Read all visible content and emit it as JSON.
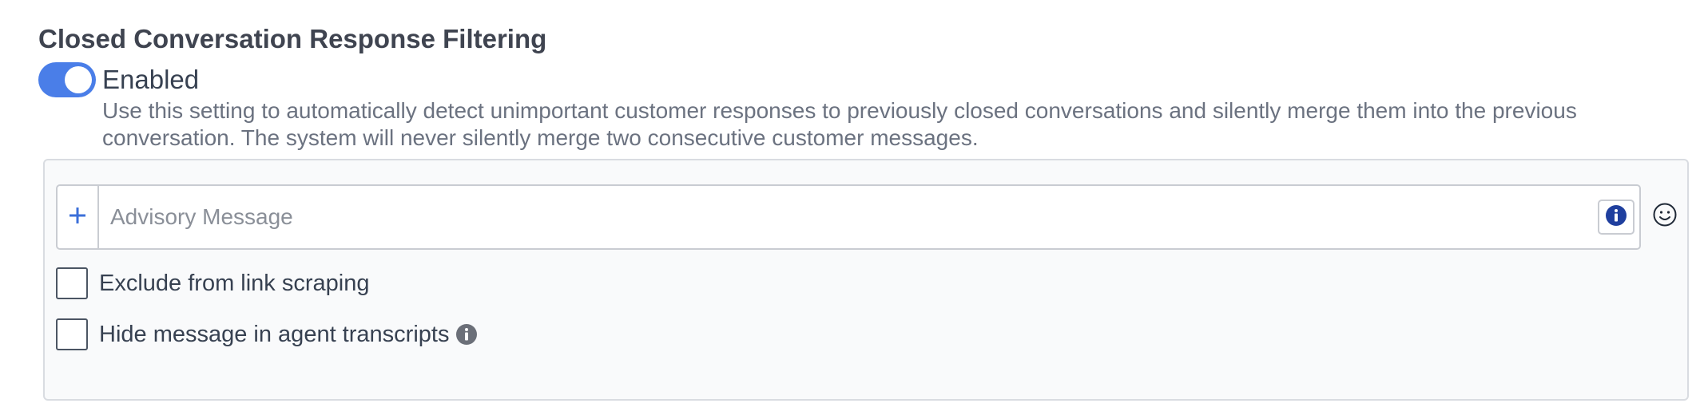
{
  "section": {
    "title": "Closed Conversation Response Filtering"
  },
  "toggle": {
    "label": "Enabled",
    "state": "on",
    "accent_color": "#4a7ee8"
  },
  "description": "Use this setting to automatically detect unimportant customer responses to previously closed conversations and silently merge them into the previous conversation. The system will never silently merge two consecutive customer messages.",
  "message_input": {
    "placeholder": "Advisory Message",
    "value": "",
    "add_icon": "plus-icon",
    "info_icon": "info-icon",
    "emoji_icon": "smiley-icon"
  },
  "options": [
    {
      "label": "Exclude from link scraping",
      "checked": false
    },
    {
      "label": "Hide message in agent transcripts",
      "checked": false,
      "help_icon": "info-icon"
    }
  ]
}
